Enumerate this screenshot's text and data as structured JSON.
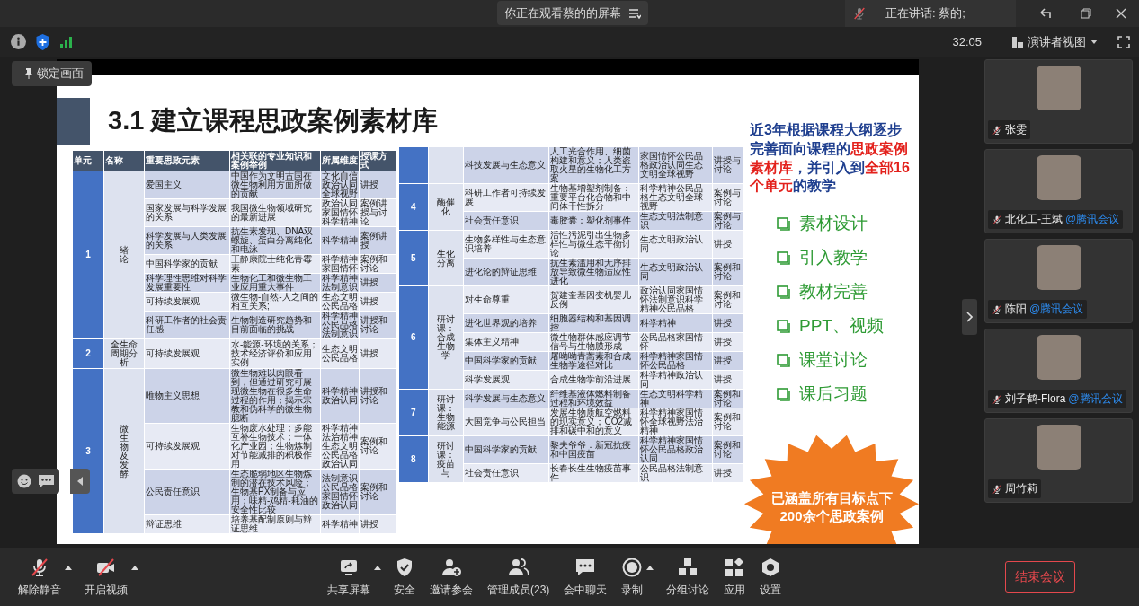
{
  "top_bar": {
    "title": "你正在观看蔡的的屏幕",
    "speaking": "正在讲话: 蔡的;"
  },
  "info_bar": {
    "timer": "32:05",
    "view": "演讲者视图"
  },
  "lock_button": "锁定画面",
  "slide": {
    "title": "3.1 建立课程思政案例素材库",
    "left_table": {
      "columns": [
        "单元",
        "名称",
        "重要思政元素",
        "相关联的专业知识和案例举例",
        "所属维度",
        "授课方式"
      ],
      "units": [
        {
          "unit": "1",
          "name": "绪论",
          "vertical": true,
          "rows": [
            {
              "element": "爱国主义",
              "knowledge": "中国作为文明古国在微生物利用方面所做的贡献",
              "dimension": "文化自信政治认同全球视野",
              "method": "讲授"
            },
            {
              "element": "国家发展与科学发展的关系",
              "knowledge": "我国微生物领域研究的最新进展",
              "dimension": "政治认同家国情怀科学精神",
              "method": "案例讲授与讨论"
            },
            {
              "element": "科学发展与人类发展的关系",
              "knowledge": "抗生素发现、DNA双螺旋、蛋白分离纯化和电泳",
              "dimension": "科学精神",
              "method": "案例讲授"
            },
            {
              "element": "中国科学家的贡献",
              "knowledge": "王静康院士纯化青霉素",
              "dimension": "科学精神家国情怀",
              "method": "案例和讨论"
            },
            {
              "element": "科学理性思维对科学发展重要性",
              "knowledge": "生物化工和微生物工业应用重大事件",
              "dimension": "科学精神法制意识",
              "method": "讲授"
            },
            {
              "element": "可持续发展观",
              "knowledge": "微生物-自然-人之间的相互关系;",
              "dimension": "生态文明公民品格",
              "method": "讲授"
            },
            {
              "element": "科研工作者的社会责任感",
              "knowledge": "生物制造研究趋势和目前面临的挑战",
              "dimension": "科学精神公民品格法制意识",
              "method": "讲授和讨论"
            }
          ]
        },
        {
          "unit": "2",
          "name": "全生命周期分析",
          "vertical": false,
          "rows": [
            {
              "element": "可持续发展观",
              "knowledge": "水-能源-环境的关系；技术经济评价和应用实例",
              "dimension": "生态文明公民品格",
              "method": "讲授"
            }
          ]
        },
        {
          "unit": "3",
          "name": "微生物及发酵",
          "vertical": true,
          "rows": [
            {
              "element": "唯物主义思想",
              "knowledge": "微生物难以肉眼看到，但通过研究可展现微生物在很多生命过程的作用；揭示宗教和伪科学的微生物臆断",
              "dimension": "科学精神政治认同",
              "method": "讲授和讨论"
            },
            {
              "element": "可持续发展观",
              "knowledge": "生物废水处理；多能互补生物技术；一体化产业园；生物炼制对节能减排的积极作用",
              "dimension": "科学精神法治精神生态文明公民品格政治认同",
              "method": "案例和讨论"
            },
            {
              "element": "公民责任意识",
              "knowledge": "生态脆弱地区生物炼制的潜在技术风险；生物基PX制备与应用；味精-鸡精-耗油的安全性比较",
              "dimension": "法制意识公民品格家国情怀政治认同",
              "method": "案例和讨论"
            },
            {
              "element": "辩证思维",
              "knowledge": "培养基配制原则与辩证思维",
              "dimension": "科学精神",
              "method": "讲授"
            }
          ]
        }
      ]
    },
    "right_table": {
      "units": [
        {
          "rows": [
            {
              "element": "科技发展与生态意义",
              "knowledge": "人工光合作用、细菌构建和意义；人类盗取火星的生物化工方案",
              "dimension": "家国情怀公民品格政治认同生态文明全球视野",
              "method": "讲授与讨论"
            }
          ]
        },
        {
          "unit": "4",
          "name": "酶催化",
          "vertical": true,
          "rows": [
            {
              "element": "科研工作者可持续发展",
              "knowledge": "生物基增塑剂制备：重要平台化合物和中间体干性拆分",
              "dimension": "科学精神公民品格生态文明全球视野",
              "method": "案例与讨论"
            },
            {
              "element": "社会责任意识",
              "knowledge": "毒胶囊：塑化剂事件",
              "dimension": "生态文明法制意识",
              "method": "案例与讨论"
            }
          ]
        },
        {
          "unit": "5",
          "name": "生化分离",
          "vertical": true,
          "rows": [
            {
              "element": "生物多样性与生态意识培养",
              "knowledge": "活性污泥引出生物多样性与微生态平衡讨论",
              "dimension": "生态文明政治认同",
              "method": "讲授"
            },
            {
              "element": "进化论的辩证思维",
              "knowledge": "抗生素滥用和无序排放导致微生物适应性进化",
              "dimension": "生态文明政治认同",
              "method": "案例和讨论"
            }
          ]
        },
        {
          "unit": "6",
          "name": "研讨课：合成生物学",
          "vertical": true,
          "rows": [
            {
              "element": "对生命尊重",
              "knowledge": "贺建奎基因变机婴儿反例",
              "dimension": "政治认同家国情怀法制意识科学精神公民品格",
              "method": "案例和讨论"
            },
            {
              "element": "进化世界观的培养",
              "knowledge": "细胞器结构和基因调控",
              "dimension": "科学精神",
              "method": "讲授"
            },
            {
              "element": "集体主义精神",
              "knowledge": "微生物群体感应调节信号与生物膜形成",
              "dimension": "公民品格家国情怀",
              "method": "讲授"
            },
            {
              "element": "中国科学家的贡献",
              "knowledge": "屠呦呦青蒿素和合成生物学途径对比",
              "dimension": "科学精神家国情怀公民品格",
              "method": "讲授"
            },
            {
              "element": "科学发展观",
              "knowledge": "合成生物学前沿进展",
              "dimension": "科学精神政治认同",
              "method": "讲授"
            }
          ]
        },
        {
          "unit": "7",
          "name": "研讨课：生物能源",
          "vertical": true,
          "rows": [
            {
              "element": "科学发展与生态意义",
              "knowledge": "纤维基液体燃料制备过程和环境效益",
              "dimension": "生态文明科学精神",
              "method": "案例和讨论"
            },
            {
              "element": "大国竞争与公民担当",
              "knowledge": "发展生物质航空燃料的现实意义；CO2减排和碳中和的意义",
              "dimension": "科学精神家国情怀全球视野法治精神",
              "method": "案例和讨论"
            }
          ]
        },
        {
          "unit": "8",
          "name": "研讨课：疫苗与",
          "vertical": true,
          "rows": [
            {
              "element": "中国科学家的贡献",
              "knowledge": "黎夫爷爷：新冠抗疫和中国疫苗",
              "dimension": "科学精神家国情怀公民品格政治认同",
              "method": "案例和讨论"
            },
            {
              "element": "社会责任意识",
              "knowledge": "长春长生生物疫苗事件",
              "dimension": "公民品格法制意识",
              "method": "讲授"
            }
          ]
        }
      ]
    },
    "summary": "近3年根据课程大纲逐步完善面向课程的**思政案例素材库**，并引入到**全部16个单元**的教学",
    "checklist": [
      "素材设计",
      "引入教学",
      "教材完善",
      "PPT、视频",
      "课堂讨论",
      "课后习题"
    ],
    "badge": "已涵盖所有目标点下200余个思政案例"
  },
  "participants": [
    {
      "name": "张雯",
      "muted": true
    },
    {
      "name": "北化工-王斌",
      "suffix": "@腾讯会议",
      "muted": true
    },
    {
      "name": "陈阳",
      "suffix": "@腾讯会议",
      "muted": true
    },
    {
      "name": "刘子鹤-Flora",
      "suffix": "@腾讯会议",
      "muted": true
    },
    {
      "name": "周竹莉",
      "muted": true
    }
  ],
  "toolbar": {
    "left": [
      {
        "kind": "mic",
        "label": "解除静音",
        "caret": true
      },
      {
        "kind": "camera",
        "label": "开启视频",
        "caret": true
      }
    ],
    "center": [
      {
        "kind": "share",
        "label": "共享屏幕",
        "caret": true
      },
      {
        "kind": "shield",
        "label": "安全",
        "caret": false
      },
      {
        "kind": "invite",
        "label": "邀请参会",
        "caret": false
      },
      {
        "kind": "members",
        "label": "管理成员(23)",
        "caret": false
      },
      {
        "kind": "chat",
        "label": "会中聊天",
        "caret": false
      },
      {
        "kind": "record",
        "label": "录制",
        "caret": true
      },
      {
        "kind": "breakout",
        "label": "分组讨论",
        "caret": false
      },
      {
        "kind": "apps",
        "label": "应用",
        "caret": false
      },
      {
        "kind": "settings",
        "label": "设置",
        "caret": false
      }
    ],
    "end_button": "结束会议"
  }
}
